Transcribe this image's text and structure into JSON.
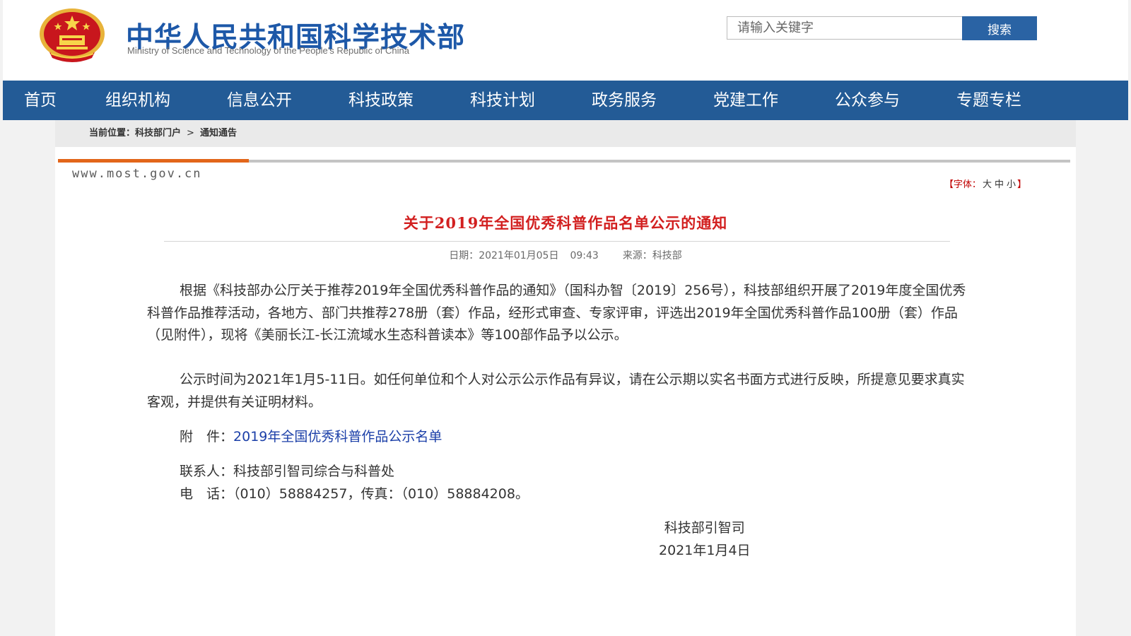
{
  "header": {
    "title": "中华人民共和国科学技术部",
    "subtitle": "Ministry of Science and Technology of the People's Republic of China",
    "emblem_icon": "national-emblem-icon"
  },
  "search": {
    "placeholder": "请输入关键字",
    "button_label": "搜索"
  },
  "nav": {
    "items": [
      {
        "label": "首页"
      },
      {
        "label": "组织机构"
      },
      {
        "label": "信息公开"
      },
      {
        "label": "科技政策"
      },
      {
        "label": "科技计划"
      },
      {
        "label": "政务服务"
      },
      {
        "label": "党建工作"
      },
      {
        "label": "公众参与"
      },
      {
        "label": "专题专栏"
      }
    ]
  },
  "breadcrumb": {
    "prefix": "当前位置：",
    "items": [
      "科技部门户",
      "通知通告"
    ],
    "separator": ">"
  },
  "article": {
    "site_url": "www.most.gov.cn",
    "font_size_control": {
      "open": "【字体：",
      "large": "大",
      "medium": "中",
      "small": "小",
      "close": "】"
    },
    "title": "关于2019年全国优秀科普作品名单公示的通知",
    "date_label": "日期：",
    "date": "2021年01月05日",
    "time": "09:43",
    "source_label": "来源：",
    "source": "科技部",
    "paragraphs": [
      "根据《科技部办公厅关于推荐2019年全国优秀科普作品的通知》（国科办智〔2019〕256号），科技部组织开展了2019年度全国优秀科普作品推荐活动，各地方、部门共推荐278册（套）作品，经形式审查、专家评审，评选出2019年全国优秀科普作品100册（套）作品（见附件），现将《美丽长江-长江流域水生态科普读本》等100部作品予以公示。",
      "公示时间为2021年1月5-11日。如任何单位和个人对公示公示作品有异议，请在公示期以实名书面方式进行反映，所提意见要求真实客观，并提供有关证明材料。"
    ],
    "attachment_label": "附　件：",
    "attachment_link": "2019年全国优秀科普作品公示名单",
    "contact_line": "联系人：科技部引智司综合与科普处",
    "phone_line": "电　话：（010）58884257，传真：（010）58884208。",
    "signoff_org": "科技部引智司",
    "signoff_date": "2021年1月4日"
  },
  "colors": {
    "brand_blue": "#1d58a8",
    "nav_bg": "#235b96",
    "search_button": "#2a63a4",
    "title_red": "#d21f1f",
    "accent_orange": "#e2661a",
    "link_blue": "#1b3fa8"
  }
}
